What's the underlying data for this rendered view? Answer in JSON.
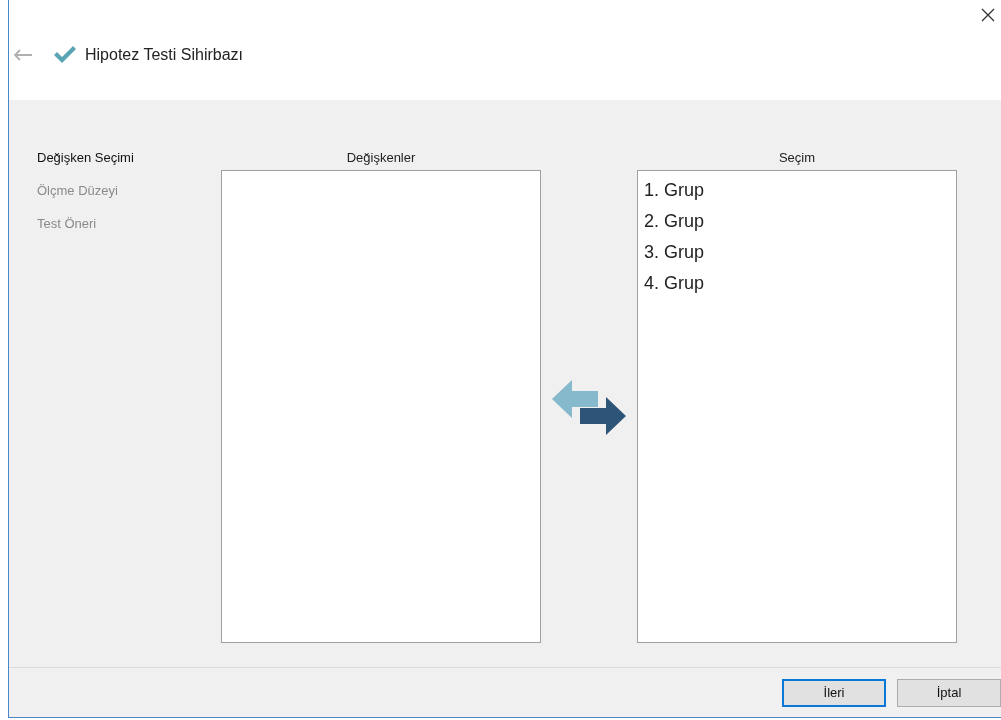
{
  "window": {
    "title": "Hipotez Testi Sihirbazı"
  },
  "steps": [
    {
      "label": "Değişken Seçimi",
      "selected": true
    },
    {
      "label": "Ölçme Düzeyi",
      "selected": false
    },
    {
      "label": "Test Öneri",
      "selected": false
    }
  ],
  "variables_list": {
    "heading": "Değişkenler"
  },
  "selection_list": {
    "heading": "Seçim",
    "items": [
      "1. Grup",
      "2. Grup",
      "3. Grup",
      "4. Grup"
    ]
  },
  "buttons": [
    {
      "label": "İleri",
      "focused": true
    },
    {
      "label": "İptal",
      "focused": false
    }
  ]
}
